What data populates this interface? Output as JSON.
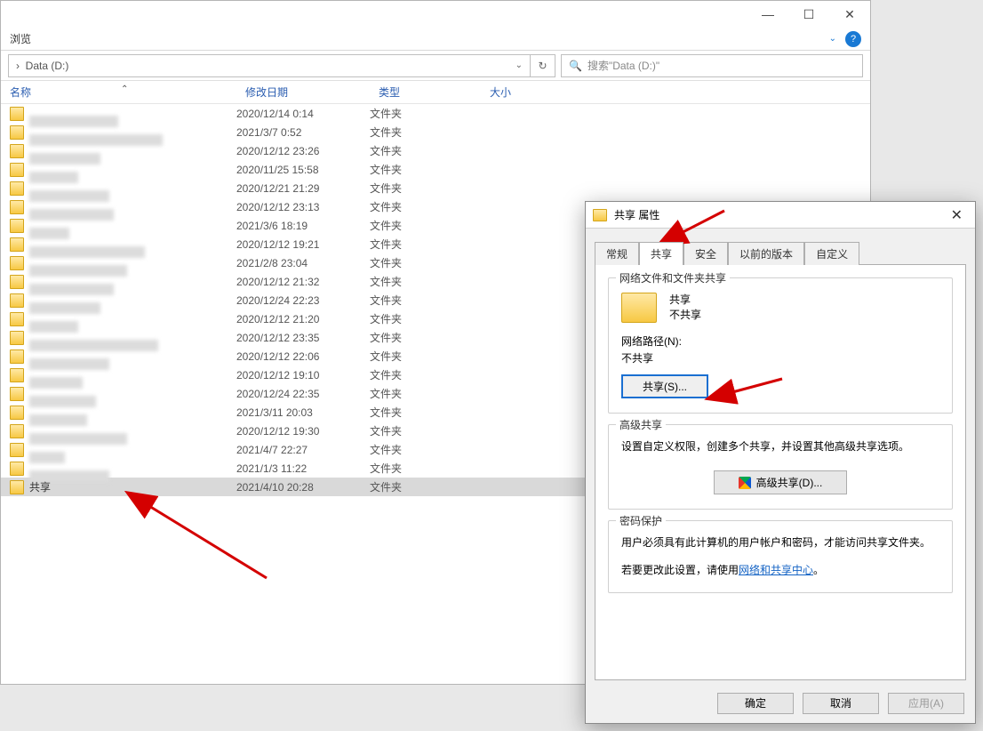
{
  "explorer": {
    "breadcrumb_label": "浏览",
    "path_prefix": "›",
    "path": "Data (D:)",
    "search_placeholder": "搜索\"Data (D:)\"",
    "columns": {
      "name": "名称",
      "date": "修改日期",
      "type": "类型",
      "size": "大小"
    },
    "folder_type": "文件夹",
    "rows": [
      {
        "blur_w": 100,
        "date": "2020/12/14 0:14"
      },
      {
        "blur_w": 150,
        "date": "2021/3/7 0:52"
      },
      {
        "blur_w": 80,
        "date": "2020/12/12 23:26"
      },
      {
        "blur_w": 55,
        "date": "2020/11/25 15:58"
      },
      {
        "blur_w": 90,
        "date": "2020/12/21 21:29"
      },
      {
        "blur_w": 95,
        "date": "2020/12/12 23:13"
      },
      {
        "blur_w": 45,
        "date": "2021/3/6 18:19"
      },
      {
        "blur_w": 130,
        "date": "2020/12/12 19:21"
      },
      {
        "blur_w": 110,
        "date": "2021/2/8 23:04"
      },
      {
        "blur_w": 95,
        "date": "2020/12/12 21:32"
      },
      {
        "blur_w": 80,
        "date": "2020/12/24 22:23"
      },
      {
        "blur_w": 55,
        "date": "2020/12/12 21:20"
      },
      {
        "blur_w": 145,
        "date": "2020/12/12 23:35"
      },
      {
        "blur_w": 90,
        "date": "2020/12/12 22:06"
      },
      {
        "blur_w": 60,
        "date": "2020/12/12 19:10"
      },
      {
        "blur_w": 75,
        "date": "2020/12/24 22:35"
      },
      {
        "blur_w": 65,
        "date": "2021/3/11 20:03"
      },
      {
        "blur_w": 110,
        "date": "2020/12/12 19:30"
      },
      {
        "blur_w": 40,
        "date": "2021/4/7 22:27"
      },
      {
        "blur_w": 90,
        "date": "2021/1/3 11:22"
      }
    ],
    "selected_row": {
      "name": "共享",
      "date": "2021/4/10 20:28"
    }
  },
  "dialog": {
    "title": "共享 属性",
    "tabs": {
      "general": "常规",
      "sharing": "共享",
      "security": "安全",
      "previous": "以前的版本",
      "custom": "自定义"
    },
    "group1_title": "网络文件和文件夹共享",
    "share_name": "共享",
    "share_status": "不共享",
    "netpath_label": "网络路径(N):",
    "netpath_value": "不共享",
    "share_button": "共享(S)...",
    "group2_title": "高级共享",
    "group2_text": "设置自定义权限，创建多个共享，并设置其他高级共享选项。",
    "adv_button": "高级共享(D)...",
    "group3_title": "密码保护",
    "group3_text": "用户必须具有此计算机的用户帐户和密码，才能访问共享文件夹。",
    "group3_text2": "若要更改此设置，请使用",
    "group3_link": "网络和共享中心",
    "group3_suffix": "。",
    "ok": "确定",
    "cancel": "取消",
    "apply": "应用(A)"
  }
}
